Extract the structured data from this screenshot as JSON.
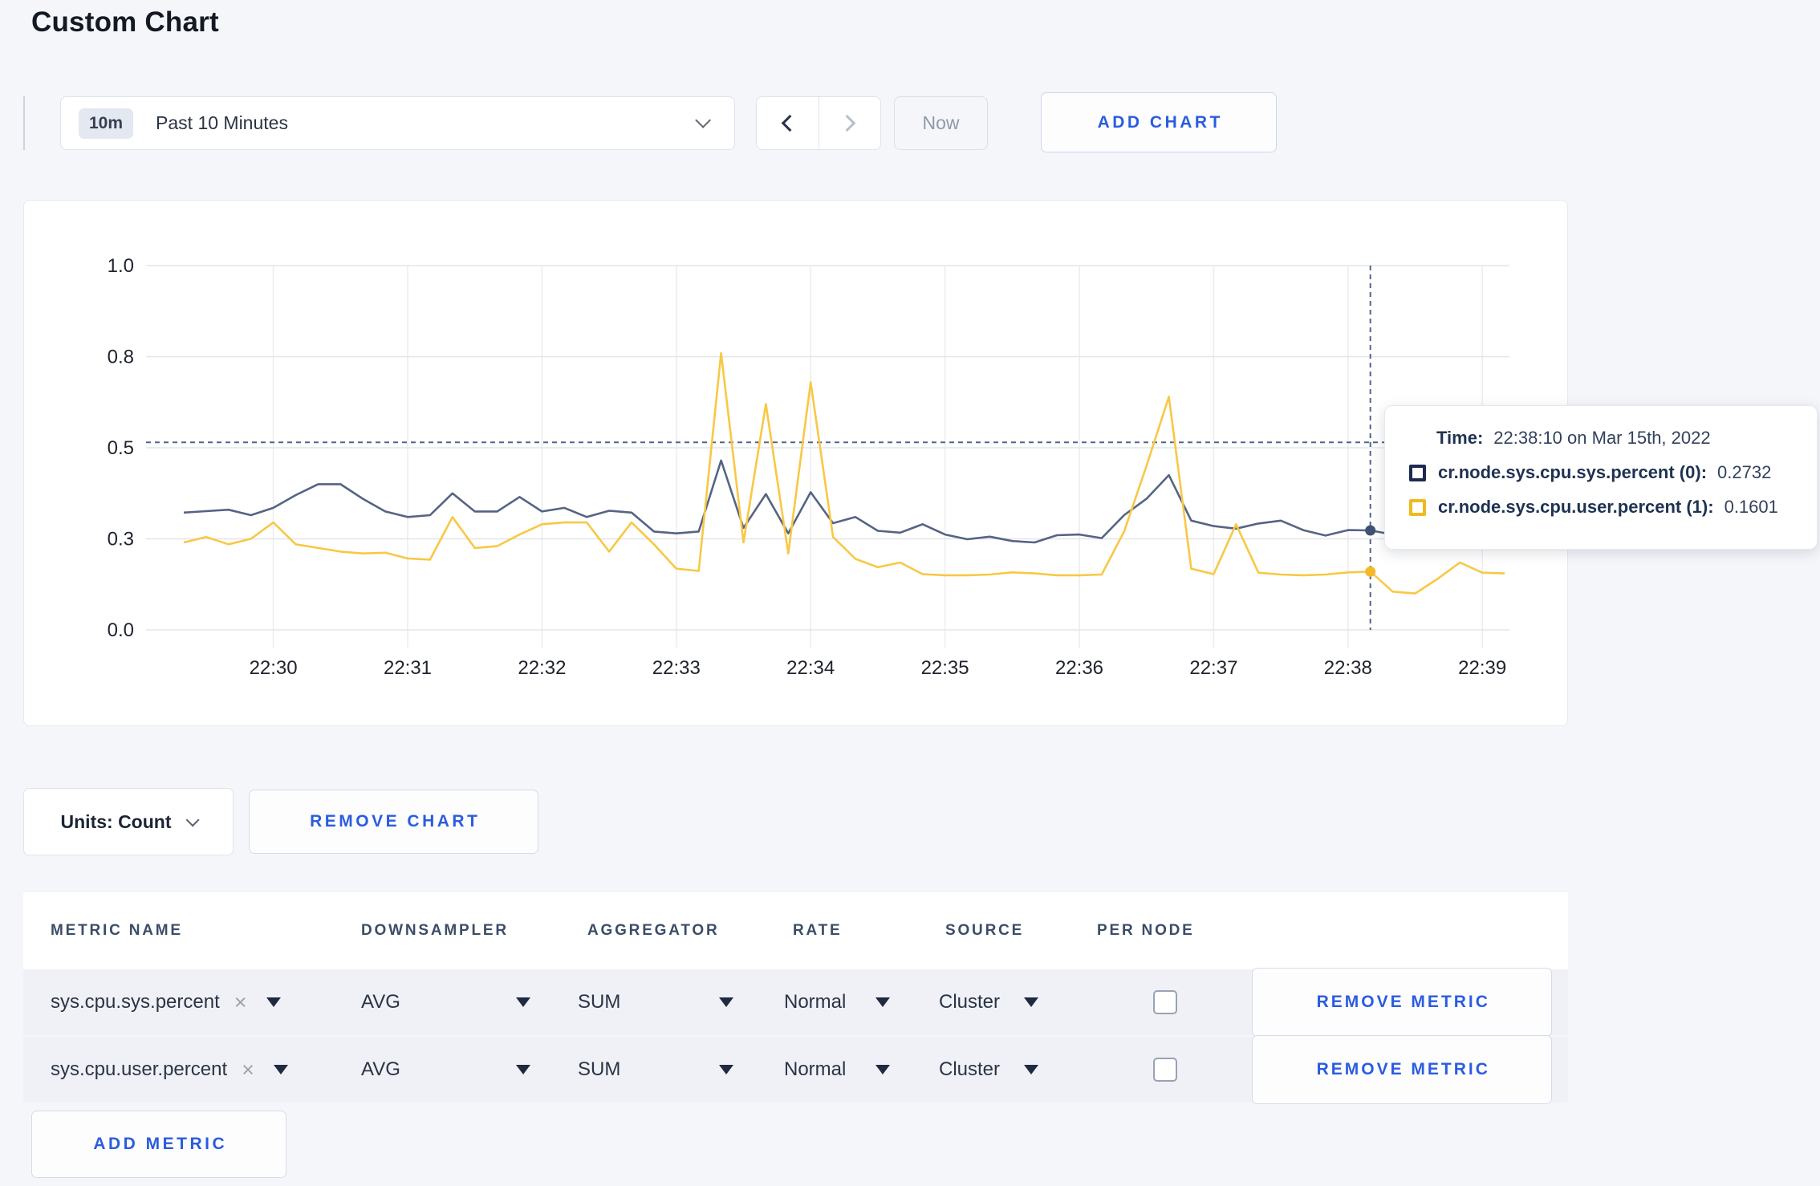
{
  "page": {
    "title": "Custom Chart",
    "background": "#f5f6fa",
    "accent_blue": "#2b5ce0"
  },
  "toolbar": {
    "time_window_badge": "10m",
    "time_window_label": "Past 10 Minutes",
    "now_label": "Now",
    "add_chart_label": "ADD CHART"
  },
  "chart_data": {
    "type": "line",
    "title": "",
    "xlabel": "",
    "ylabel": "",
    "x_type": "time",
    "start_time": "22:29:20",
    "interval_seconds": 10,
    "ylim": [
      0,
      1
    ],
    "grid": true,
    "y_ticks": [
      {
        "v": 0.0,
        "label": "0.0"
      },
      {
        "v": 0.25,
        "label": "0.3"
      },
      {
        "v": 0.5,
        "label": "0.5"
      },
      {
        "v": 0.75,
        "label": "0.8"
      },
      {
        "v": 1.0,
        "label": "1.0"
      }
    ],
    "x_tick_labels": [
      "22:30",
      "22:31",
      "22:32",
      "22:33",
      "22:34",
      "22:35",
      "22:36",
      "22:37",
      "22:38",
      "22:39"
    ],
    "x_tick_indices": [
      4,
      10,
      16,
      22,
      28,
      34,
      40,
      46,
      52,
      58
    ],
    "series": [
      {
        "name": "cr.node.sys.cpu.sys.percent",
        "color": "#556484",
        "dot_color": "#3f5274",
        "values": [
          0.322,
          0.326,
          0.33,
          0.315,
          0.335,
          0.37,
          0.4,
          0.4,
          0.36,
          0.325,
          0.31,
          0.315,
          0.375,
          0.325,
          0.325,
          0.365,
          0.325,
          0.335,
          0.31,
          0.327,
          0.322,
          0.27,
          0.265,
          0.27,
          0.465,
          0.28,
          0.373,
          0.265,
          0.378,
          0.293,
          0.31,
          0.272,
          0.267,
          0.29,
          0.262,
          0.249,
          0.256,
          0.244,
          0.24,
          0.26,
          0.262,
          0.252,
          0.315,
          0.36,
          0.425,
          0.3,
          0.285,
          0.278,
          0.292,
          0.3,
          0.274,
          0.259,
          0.274,
          0.2732,
          0.262,
          0.266,
          0.29,
          0.282,
          0.295,
          0.29
        ]
      },
      {
        "name": "cr.node.sys.cpu.user.percent",
        "color": "#f8c845",
        "dot_color": "#f2b927",
        "values": [
          0.24,
          0.255,
          0.235,
          0.25,
          0.295,
          0.235,
          0.225,
          0.215,
          0.21,
          0.212,
          0.196,
          0.193,
          0.31,
          0.225,
          0.23,
          0.262,
          0.29,
          0.295,
          0.295,
          0.215,
          0.295,
          0.235,
          0.168,
          0.162,
          0.76,
          0.24,
          0.62,
          0.21,
          0.68,
          0.255,
          0.195,
          0.172,
          0.185,
          0.153,
          0.15,
          0.15,
          0.152,
          0.158,
          0.155,
          0.15,
          0.15,
          0.152,
          0.27,
          0.45,
          0.64,
          0.168,
          0.153,
          0.29,
          0.157,
          0.152,
          0.15,
          0.152,
          0.158,
          0.1601,
          0.105,
          0.1,
          0.14,
          0.185,
          0.157,
          0.155
        ]
      }
    ],
    "crosshair": {
      "index": 53,
      "time": "22:38:10",
      "h_value": 0.515
    },
    "legend_position": "none"
  },
  "tooltip": {
    "time_label": "Time:",
    "time_value": "22:38:10 on Mar 15th, 2022",
    "series": [
      {
        "label": "cr.node.sys.cpu.sys.percent (0):",
        "value": "0.2732",
        "swatch_color": "#1b2c4f"
      },
      {
        "label": "cr.node.sys.cpu.user.percent (1):",
        "value": "0.1601",
        "swatch_color": "#f0ba1e"
      }
    ]
  },
  "chart_controls": {
    "units_label": "Units: Count",
    "remove_chart_label": "REMOVE CHART"
  },
  "metrics_table": {
    "headers": [
      "METRIC NAME",
      "DOWNSAMPLER",
      "AGGREGATOR",
      "RATE",
      "SOURCE",
      "PER NODE"
    ],
    "rows": [
      {
        "metric": "sys.cpu.sys.percent",
        "downsampler": "AVG",
        "aggregator": "SUM",
        "rate": "Normal",
        "source": "Cluster",
        "per_node_checked": false,
        "remove_label": "REMOVE METRIC"
      },
      {
        "metric": "sys.cpu.user.percent",
        "downsampler": "AVG",
        "aggregator": "SUM",
        "rate": "Normal",
        "source": "Cluster",
        "per_node_checked": false,
        "remove_label": "REMOVE METRIC"
      }
    ],
    "add_metric_label": "ADD METRIC"
  },
  "icons": {
    "clear": "×"
  }
}
